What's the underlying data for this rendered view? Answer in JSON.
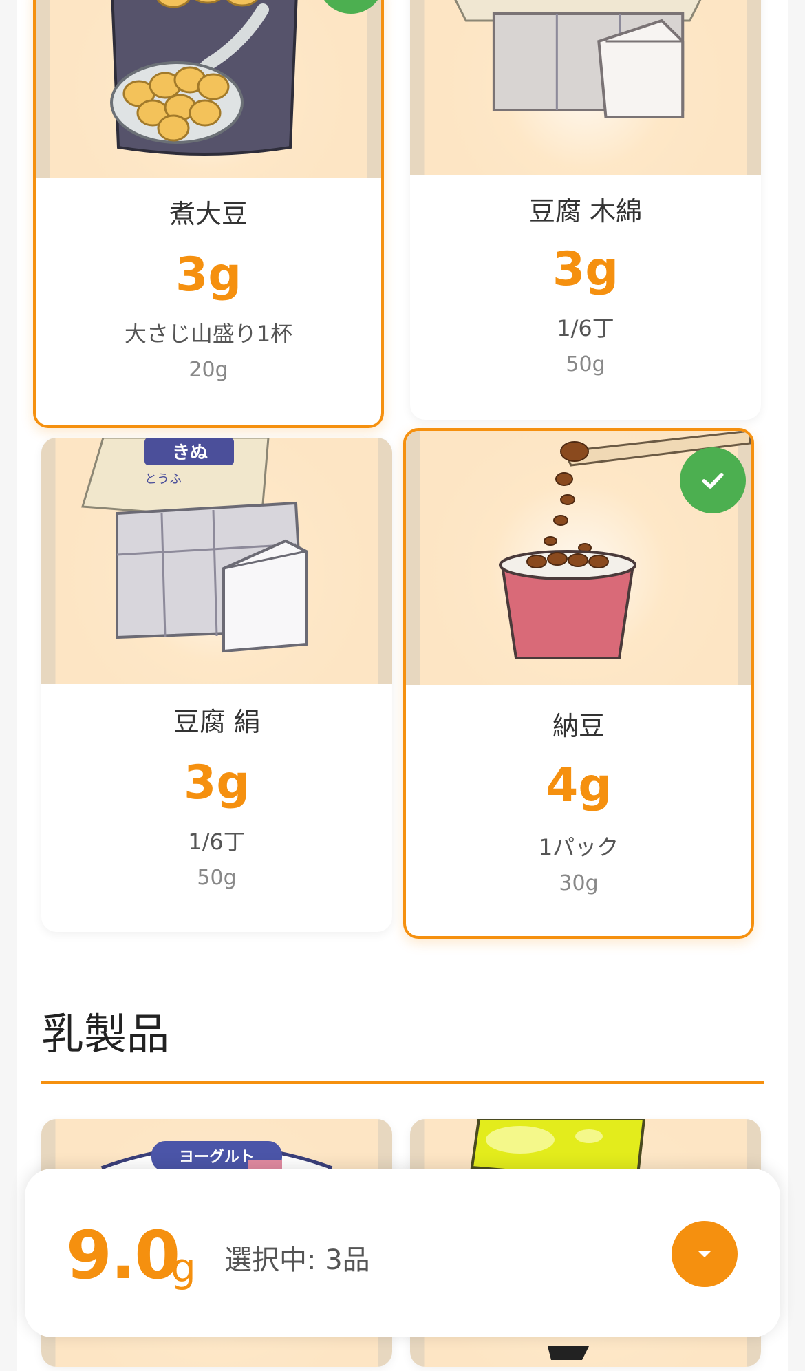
{
  "foods": [
    {
      "name": "煮大豆",
      "protein": "3g",
      "portion": "大さじ山盛り1杯",
      "weight": "20g",
      "selected": true,
      "icon": "boiled-soybeans-illustration"
    },
    {
      "name": "豆腐 木綿",
      "protein": "3g",
      "portion": "1/6丁",
      "weight": "50g",
      "selected": false,
      "icon": "firm-tofu-illustration"
    },
    {
      "name": "豆腐 絹",
      "protein": "3g",
      "portion": "1/6丁",
      "weight": "50g",
      "selected": false,
      "icon": "silken-tofu-illustration"
    },
    {
      "name": "納豆",
      "protein": "4g",
      "portion": "1パック",
      "weight": "30g",
      "selected": true,
      "icon": "natto-illustration"
    }
  ],
  "dairy_section": {
    "title": "乳製品",
    "items": [
      {
        "icon": "yogurt-illustration",
        "label": "ヨーグルト"
      },
      {
        "icon": "cheese-illustration"
      }
    ]
  },
  "tofu_package_label": [
    "きぬ",
    "とうふ"
  ],
  "summary": {
    "total": "9.0",
    "unit": "g",
    "count": "選択中: 3品"
  },
  "colors": {
    "accent": "#f5900f",
    "check": "#4caf50"
  }
}
